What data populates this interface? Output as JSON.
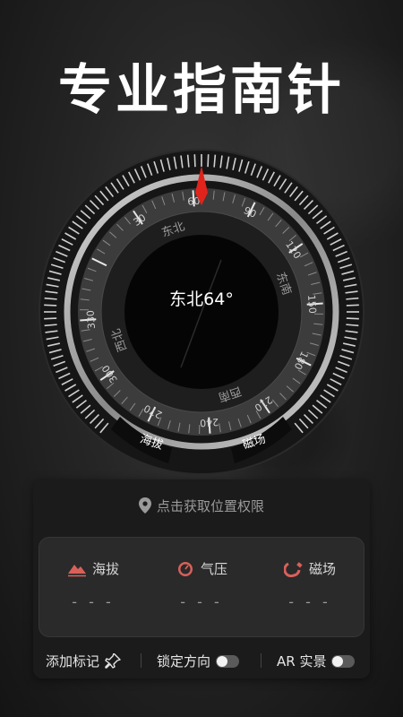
{
  "headline": "专业指南针",
  "compass": {
    "heading_text": "东北64°",
    "heading_degrees": 64,
    "direction_labels": [
      "东北",
      "东南",
      "西南",
      "西北"
    ],
    "degree_labels": [
      "30",
      "60",
      "90",
      "120",
      "150",
      "180",
      "210",
      "240",
      "270",
      "300",
      "330"
    ],
    "badge_left": "海拔",
    "badge_right": "磁场",
    "needle_color": "#e0241b"
  },
  "location": {
    "prompt": "点击获取位置权限",
    "icon": "location-pin-icon"
  },
  "metrics": [
    {
      "label": "海拔",
      "icon": "mountain-icon",
      "value": "- - -"
    },
    {
      "label": "气压",
      "icon": "gauge-icon",
      "value": "- - -"
    },
    {
      "label": "磁场",
      "icon": "magnet-icon",
      "value": "- - -"
    }
  ],
  "bottom_bar": {
    "add_marker": "添加标记",
    "lock_direction": "锁定方向",
    "ar_view": "AR 实景"
  },
  "colors": {
    "accent_red": "#e0241b",
    "icon_red": "#d9605a"
  }
}
